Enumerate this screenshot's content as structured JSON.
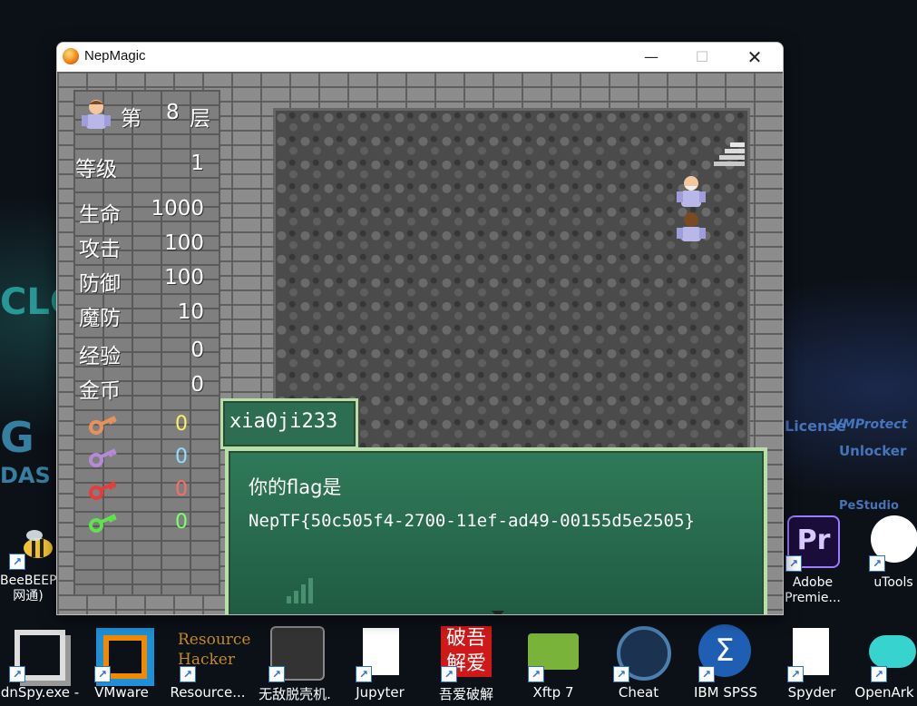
{
  "window": {
    "title": "NepMagic"
  },
  "stats": {
    "floor_prefix": "第",
    "floor": "8",
    "floor_suffix": "层",
    "rows": [
      {
        "label": "等级",
        "value": "1"
      },
      {
        "label": "生命",
        "value": "1000"
      },
      {
        "label": "攻击",
        "value": "100"
      },
      {
        "label": "防御",
        "value": "100"
      },
      {
        "label": "魔防",
        "value": "10"
      },
      {
        "label": "经验",
        "value": "0"
      },
      {
        "label": "金币",
        "value": "0"
      }
    ],
    "keys": [
      {
        "icon": "orange-key-icon",
        "color": "#e8925a",
        "value": "0",
        "value_color": "#ffee66"
      },
      {
        "icon": "purple-key-icon",
        "color": "#b58ad6",
        "value": "0",
        "value_color": "#8fe0ff"
      },
      {
        "icon": "red-key-icon",
        "color": "#e83c3c",
        "value": "0",
        "value_color": "#ff6a6a"
      },
      {
        "icon": "green-key-icon",
        "color": "#5fe34d",
        "value": "0",
        "value_color": "#7dff6e"
      }
    ]
  },
  "dialog": {
    "speaker": "xia0ji233",
    "line1": "你的flag是",
    "line2": "NepTF{50c505f4-2700-11ef-ad49-00155d5e2505}"
  },
  "desktop": {
    "left_icon": {
      "label1": "BeeBEEP",
      "label2": "网通)"
    },
    "right_icons": [
      {
        "label1": "Adobe",
        "label2": "Premie..."
      },
      {
        "label1": "uTools"
      }
    ],
    "taskbar": [
      {
        "label": "dnSpy.exe -",
        "icon": "dnspy-icon"
      },
      {
        "label": "VMware",
        "icon": "vmware-icon"
      },
      {
        "label": "Resource...",
        "icon": "resource-hacker-icon"
      },
      {
        "label": "无敌脱壳机.",
        "icon": "unpacker-icon"
      },
      {
        "label": "Jupyter",
        "icon": "jupyter-icon"
      },
      {
        "label": "吾爱破解",
        "icon": "52pojie-icon"
      },
      {
        "label": "Xftp 7",
        "icon": "xftp-icon"
      },
      {
        "label": "Cheat",
        "icon": "cheat-engine-icon"
      },
      {
        "label": "IBM SPSS",
        "icon": "spss-icon"
      },
      {
        "label": "Spyder",
        "icon": "spyder-icon"
      },
      {
        "label": "OpenArk",
        "icon": "openark-icon"
      }
    ],
    "resource_text": "Resource Hacker",
    "pojie_text": "破吾解爱"
  }
}
